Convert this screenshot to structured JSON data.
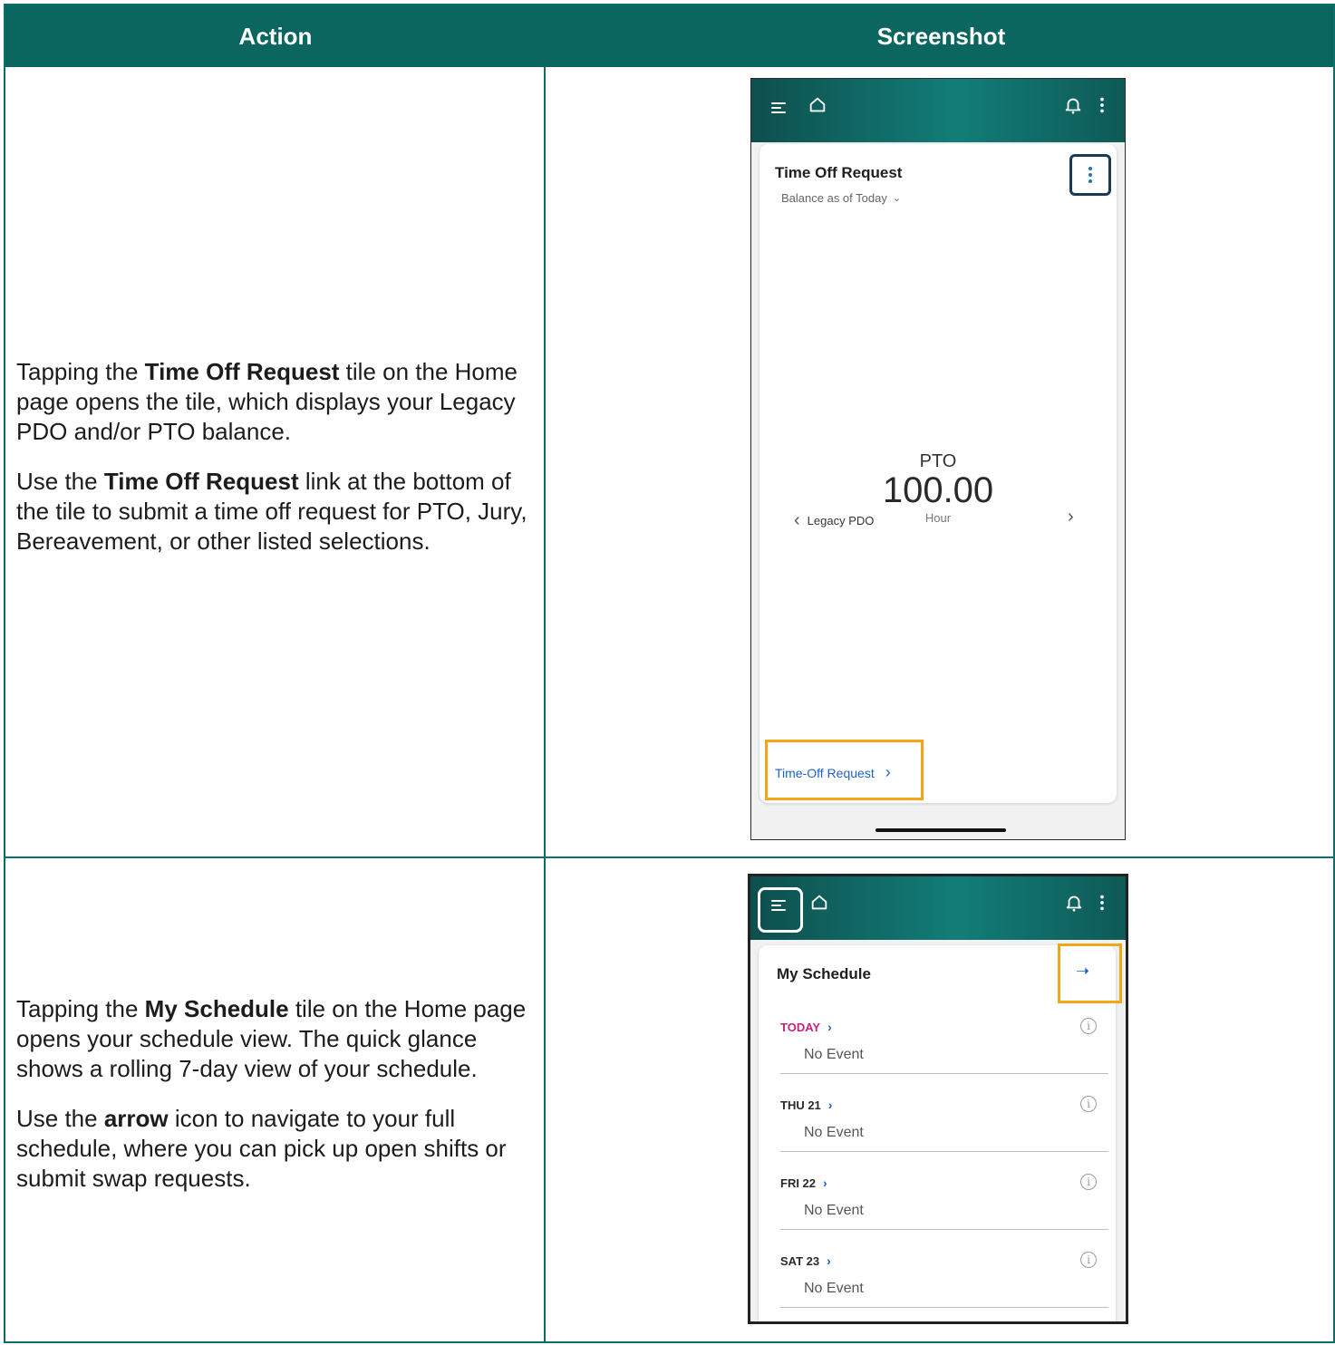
{
  "table": {
    "headers": {
      "action": "Action",
      "screenshot": "Screenshot"
    },
    "rows": [
      {
        "action_paragraphs": [
          {
            "parts": [
              "Tapping the ",
              "Time Off Request",
              " tile on the Home page opens the tile, which displays your Legacy PDO and/or PTO balance."
            ]
          },
          {
            "parts": [
              "Use the ",
              "Time Off Request",
              " link at the bottom of the tile to submit a time off request for PTO, Jury, Bereavement, or other listed selections."
            ]
          }
        ]
      },
      {
        "action_paragraphs": [
          {
            "parts": [
              "Tapping the ",
              "My Schedule",
              " tile on the Home page opens your schedule view.  The quick glance shows a rolling 7-day view of your schedule."
            ]
          },
          {
            "parts": [
              "Use the ",
              "arrow",
              " icon to navigate to your full schedule, where you can pick up open shifts or submit swap requests."
            ]
          }
        ]
      }
    ]
  },
  "screen1": {
    "tile_title": "Time Off Request",
    "balance_dropdown": "Balance as of Today",
    "accrual_name": "PTO",
    "accrual_value": "100.00",
    "accrual_unit": "Hour",
    "prev_accrual": "Legacy PDO",
    "link_label": "Time-Off Request"
  },
  "screen2": {
    "tile_title": "My Schedule",
    "days": [
      {
        "label": "TODAY",
        "event": "No Event"
      },
      {
        "label": "THU 21",
        "event": "No Event"
      },
      {
        "label": "FRI 22",
        "event": "No Event"
      },
      {
        "label": "SAT 23",
        "event": "No Event"
      }
    ]
  },
  "colors": {
    "header_bg": "#0b6660",
    "highlight": "#f3a51c",
    "link": "#1e63c4",
    "today": "#c4237e"
  },
  "icons": [
    "menu-icon",
    "home-icon",
    "bell-icon",
    "more-vertical-icon",
    "chevron-down-icon",
    "chevron-left-icon",
    "chevron-right-icon",
    "arrow-right-icon",
    "info-icon"
  ]
}
